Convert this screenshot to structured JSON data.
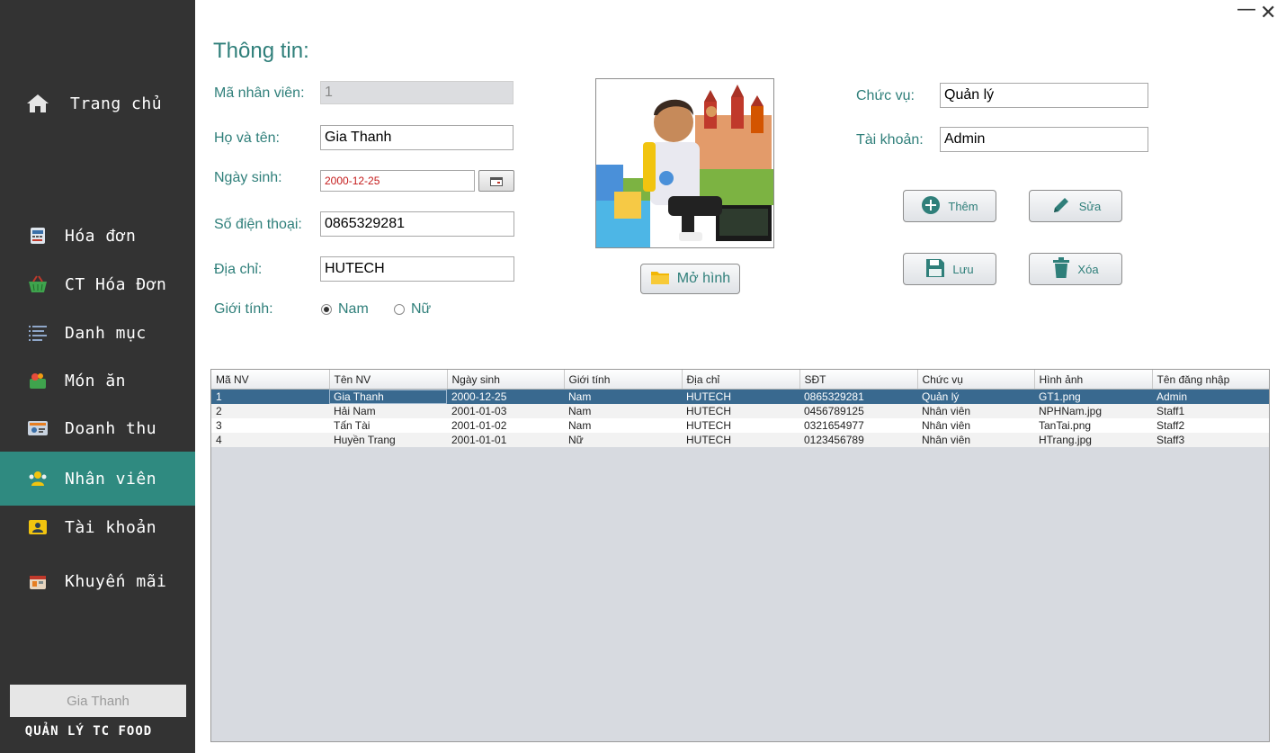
{
  "window": {
    "minimize": "—",
    "close": "✕"
  },
  "sidebar": {
    "items": [
      {
        "label": "Trang chủ",
        "icon": "home-icon"
      },
      {
        "label": "Hóa đơn",
        "icon": "receipt-icon"
      },
      {
        "label": "CT Hóa Đơn",
        "icon": "basket-icon"
      },
      {
        "label": "Danh mục",
        "icon": "list-icon"
      },
      {
        "label": "Món ăn",
        "icon": "food-icon"
      },
      {
        "label": "Doanh thu",
        "icon": "revenue-icon"
      },
      {
        "label": "Nhân viên",
        "icon": "staff-icon"
      },
      {
        "label": "Tài khoản",
        "icon": "account-icon"
      },
      {
        "label": "Khuyến mãi",
        "icon": "promotion-icon"
      }
    ],
    "active_color": "#2f8a80",
    "user": "Gia Thanh",
    "app_name": "QUẢN LÝ TC FOOD"
  },
  "form": {
    "title": "Thông tin:",
    "employee_id_label": "Mã nhân viên:",
    "employee_id": "1",
    "name_label": "Họ và tên:",
    "name": "Gia Thanh",
    "dob_label": "Ngày sinh:",
    "dob": "2000-12-25",
    "phone_label": "Số điện thoại:",
    "phone": "0865329281",
    "address_label": "Địa chỉ:",
    "address": "HUTECH",
    "gender_label": "Giới tính:",
    "gender_male": "Nam",
    "gender_female": "Nữ",
    "position_label": "Chức vụ:",
    "position": "Quản lý",
    "account_label": "Tài khoản:",
    "account": "Admin"
  },
  "buttons": {
    "open_image": "Mở hình",
    "add": "Thêm",
    "edit": "Sửa",
    "save": "Lưu",
    "delete": "Xóa"
  },
  "table": {
    "headers": [
      "Mã NV",
      "Tên NV",
      "Ngày sinh",
      "Giới tính",
      "Địa chỉ",
      "SĐT",
      "Chức vụ",
      "Hình ảnh",
      "Tên đăng nhập"
    ],
    "rows": [
      [
        "1",
        "Gia Thanh",
        "2000-12-25",
        "Nam",
        "HUTECH",
        "0865329281",
        "Quản lý",
        "GT1.png",
        "Admin"
      ],
      [
        "2",
        "Hải Nam",
        "2001-01-03",
        "Nam",
        "HUTECH",
        "0456789125",
        "Nhân viên",
        "NPHNam.jpg",
        "Staff1"
      ],
      [
        "3",
        "Tấn Tài",
        "2001-01-02",
        "Nam",
        "HUTECH",
        "0321654977",
        "Nhân viên",
        "TanTai.png",
        "Staff2"
      ],
      [
        "4",
        "Huyền Trang",
        "2001-01-01",
        "Nữ",
        "HUTECH",
        "0123456789",
        "Nhân viên",
        "HTrang.jpg",
        "Staff3"
      ]
    ],
    "selected_row_color": "#39698f"
  }
}
